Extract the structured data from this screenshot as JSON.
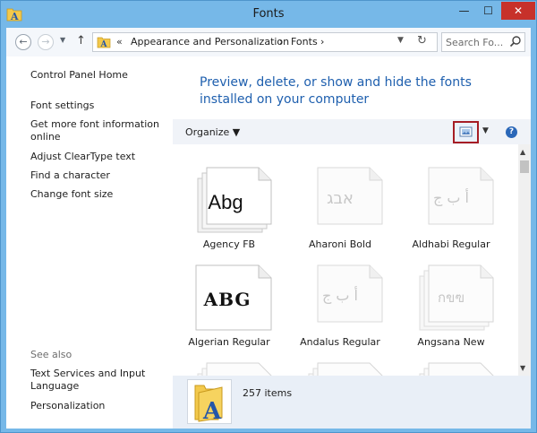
{
  "window": {
    "title": "Fonts"
  },
  "title_buttons": {
    "minimize": "—",
    "maximize": "☐",
    "close": "✕"
  },
  "nav": {
    "back": "←",
    "forward": "→",
    "recent": "▼",
    "up": "↑"
  },
  "address": {
    "overflow": "«",
    "crumbs": [
      "Appearance and Personalization",
      "Fonts"
    ],
    "separator": "›",
    "dropdown": "▼",
    "refresh": "↻"
  },
  "search": {
    "placeholder": "Search Fo..."
  },
  "left_pane": {
    "home": "Control Panel Home",
    "links": [
      "Font settings",
      "Get more font information online",
      "Adjust ClearType text",
      "Find a character",
      "Change font size"
    ],
    "see_also_label": "See also",
    "see_also": [
      "Text Services and Input Language",
      "Personalization"
    ]
  },
  "heading": "Preview, delete, or show and hide the fonts installed on your computer",
  "toolbar": {
    "organize": "Organize ▼",
    "view_dropdown": "▼",
    "help": "?"
  },
  "fonts": [
    {
      "name": "Agency FB",
      "sample": "Abg"
    },
    {
      "name": "Aharoni Bold",
      "sample": "אבג"
    },
    {
      "name": "Aldhabi Regular",
      "sample": "أ ب ج"
    },
    {
      "name": "Algerian Regular",
      "sample": "ABG"
    },
    {
      "name": "Andalus Regular",
      "sample": "أ ب ج"
    },
    {
      "name": "Angsana New",
      "sample": "กขฃ"
    }
  ],
  "scrollbar": {
    "up": "▲",
    "down": "▼"
  },
  "status": {
    "count": "257 items"
  },
  "colors": {
    "accent": "#1e5fae",
    "title_bar": "#76b8e8",
    "close_button": "#c7312a",
    "view_highlight": "#a61d25"
  }
}
